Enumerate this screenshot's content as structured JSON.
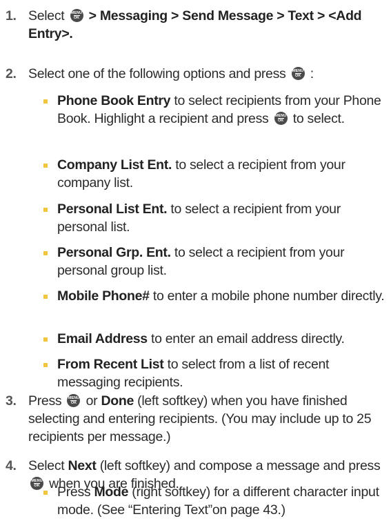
{
  "menu_key": {
    "top": "MENU",
    "bottom": "OK"
  },
  "steps": [
    {
      "num": "1.",
      "p1": "Select ",
      "p2": " > Messaging > Send Message > Text > <Add Entry>."
    },
    {
      "num": "2.",
      "p1": "Select one of the following options and press ",
      "p2": " :"
    },
    {
      "num": "3.",
      "p1": "Press ",
      "p2": " or ",
      "bold": "Done",
      "p3": " (left softkey) when you have finished selecting and entering recipients. (You may include up to 25 recipients per message.)"
    },
    {
      "num": "4.",
      "p1": "Select ",
      "bold": "Next",
      "p2": " (left softkey) and compose a message and press ",
      "p3": " when you are finished."
    }
  ],
  "options": [
    {
      "bold": "Phone Book Entry",
      "text": " to select recipients from your Phone Book. Highlight a recipient and press ",
      "text2": " to select."
    },
    {
      "bold": "Company List Ent.",
      "text": " to select a recipient from your company list."
    },
    {
      "bold": "Personal List Ent.",
      "text": " to select a recipient from your personal list."
    },
    {
      "bold": "Personal Grp. Ent.",
      "text": " to select a recipient from your personal group list."
    },
    {
      "bold": "Mobile Phone#",
      "text": " to enter a mobile phone number directly."
    },
    {
      "bold": "Email Address",
      "text": " to enter an email address directly."
    },
    {
      "bold": "From Recent List",
      "text": " to select from a list of recent messaging recipients."
    }
  ],
  "sub_bullets": [
    {
      "p1": "Press ",
      "bold": "Mode",
      "p2": " (right softkey) for a different character input mode. (See “Entering Text”on page 43.)"
    }
  ],
  "colors": {
    "bullet": "#f2c53d",
    "step_number": "#555555",
    "menu_key": "#4a4a4a"
  }
}
